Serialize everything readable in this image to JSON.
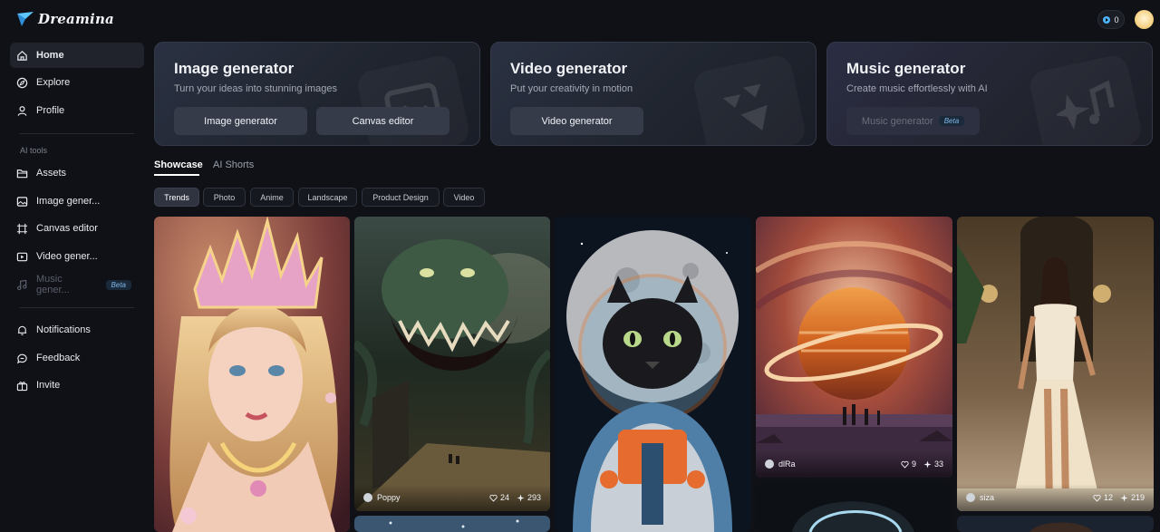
{
  "app": {
    "logo_text": "Dreamina"
  },
  "sidebar": {
    "items": [
      {
        "label": "Home",
        "icon": "home-icon"
      },
      {
        "label": "Explore",
        "icon": "explore-icon"
      },
      {
        "label": "Profile",
        "icon": "profile-icon"
      }
    ],
    "section_label": "AI tools",
    "tools": [
      {
        "label": "Assets",
        "icon": "folder-icon"
      },
      {
        "label": "Image gener...",
        "icon": "image-icon"
      },
      {
        "label": "Canvas editor",
        "icon": "canvas-icon"
      },
      {
        "label": "Video gener...",
        "icon": "video-icon"
      },
      {
        "label": "Music gener...",
        "icon": "music-icon",
        "badge": "Beta"
      }
    ],
    "bottom": [
      {
        "label": "Notifications",
        "icon": "bell-icon"
      },
      {
        "label": "Feedback",
        "icon": "feedback-icon"
      },
      {
        "label": "Invite",
        "icon": "invite-icon"
      }
    ]
  },
  "header": {
    "credits": "0"
  },
  "generators": [
    {
      "title": "Image generator",
      "subtitle": "Turn your ideas into stunning images",
      "buttons": [
        "Image generator",
        "Canvas editor"
      ]
    },
    {
      "title": "Video generator",
      "subtitle": "Put your creativity in motion",
      "buttons": [
        "Video generator"
      ]
    },
    {
      "title": "Music generator",
      "subtitle": "Create music effortlessly with AI",
      "buttons": [
        "Music generator"
      ],
      "badge": "Beta"
    }
  ],
  "tabs": [
    "Showcase",
    "AI Shorts"
  ],
  "filters": [
    "Trends",
    "Photo",
    "Anime",
    "Landscape",
    "Product Design",
    "Video"
  ],
  "gallery": [
    {
      "subject": "crowned princess portrait"
    },
    {
      "subject": "tentacled monster",
      "author": "Poppy",
      "likes": "24",
      "remixes": "293"
    },
    {
      "subject": "astronaut cat in front of the moon"
    },
    {
      "subject": "ringed planet over figures",
      "author": "dlRa",
      "likes": "9",
      "remixes": "33"
    },
    {
      "subject": "woman in white gown",
      "author": "siza",
      "likes": "12",
      "remixes": "219"
    }
  ],
  "colors": {
    "background": "#0f1116",
    "accent": "#4db7ff",
    "card": "#262c3a"
  }
}
